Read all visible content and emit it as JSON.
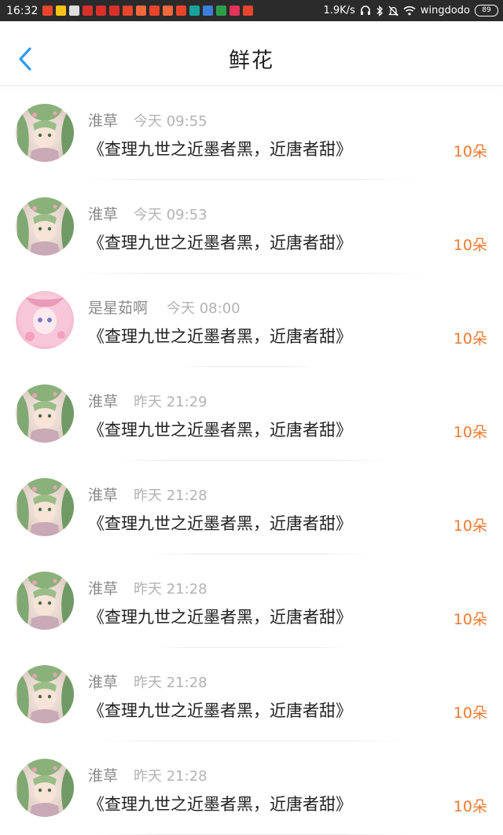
{
  "status_bar": {
    "time": "16:32",
    "speed": "1.9K/s",
    "carrier": "wingdodo",
    "battery": "89",
    "notification_icons": [
      {
        "name": "app-notify-icon",
        "color": "#e8452c"
      },
      {
        "name": "star-icon",
        "color": "#f5c518"
      },
      {
        "name": "calendar-icon",
        "color": "#dddddd"
      },
      {
        "name": "app-notify-icon",
        "color": "#d9302c"
      },
      {
        "name": "app-notify-icon",
        "color": "#d9302c"
      },
      {
        "name": "app-notify-icon",
        "color": "#d9302c"
      },
      {
        "name": "app-notify-icon",
        "color": "#e8452c"
      },
      {
        "name": "app-notify-icon",
        "color": "#f0683c"
      },
      {
        "name": "app-notify-icon",
        "color": "#e8452c"
      },
      {
        "name": "app-notify-icon",
        "color": "#f0683c"
      },
      {
        "name": "app-notify-icon",
        "color": "#e8452c"
      },
      {
        "name": "app-notify-icon",
        "color": "#1aa39a"
      },
      {
        "name": "app-notify-icon",
        "color": "#3b7fd8"
      },
      {
        "name": "app-notify-icon",
        "color": "#2e9e4a"
      },
      {
        "name": "app-notify-icon",
        "color": "#e2335a"
      },
      {
        "name": "app-notify-icon",
        "color": "#e8452c"
      }
    ]
  },
  "header": {
    "title": "鲜花",
    "back_icon": "chevron-left-icon",
    "accent_color": "#2d9cf0"
  },
  "flowers": [
    {
      "name": "淮草",
      "time": "今天 09:55",
      "title": "《查理九世之近墨者黑，近唐者甜》",
      "count": "10朵",
      "avatar": "green"
    },
    {
      "name": "淮草",
      "time": "今天 09:53",
      "title": "《查理九世之近墨者黑，近唐者甜》",
      "count": "10朵",
      "avatar": "green"
    },
    {
      "name": "是星茹啊",
      "time": "今天 08:00",
      "title": "《查理九世之近墨者黑，近唐者甜》",
      "count": "10朵",
      "avatar": "pink"
    },
    {
      "name": "淮草",
      "time": "昨天 21:29",
      "title": "《查理九世之近墨者黑，近唐者甜》",
      "count": "10朵",
      "avatar": "green"
    },
    {
      "name": "淮草",
      "time": "昨天 21:28",
      "title": "《查理九世之近墨者黑，近唐者甜》",
      "count": "10朵",
      "avatar": "green"
    },
    {
      "name": "淮草",
      "time": "昨天 21:28",
      "title": "《查理九世之近墨者黑，近唐者甜》",
      "count": "10朵",
      "avatar": "green"
    },
    {
      "name": "淮草",
      "time": "昨天 21:28",
      "title": "《查理九世之近墨者黑，近唐者甜》",
      "count": "10朵",
      "avatar": "green"
    },
    {
      "name": "淮草",
      "time": "昨天 21:28",
      "title": "《查理九世之近墨者黑，近唐者甜》",
      "count": "10朵",
      "avatar": "green"
    }
  ]
}
